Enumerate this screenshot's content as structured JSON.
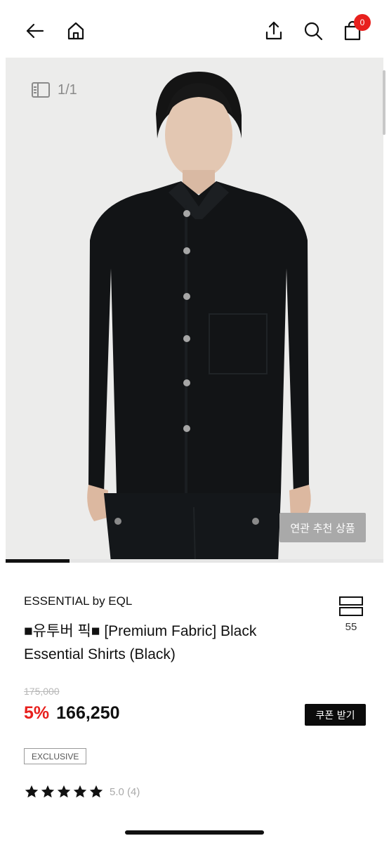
{
  "header": {
    "cart_count": "0"
  },
  "gallery": {
    "counter": "1/1",
    "related_label": "연관 추천 상품",
    "progress": 0.17
  },
  "product": {
    "brand": "ESSENTIAL by EQL",
    "title_line1": "■유투버 픽■ [Premium Fabric] Black",
    "title_line2": "Essential Shirts (Black)",
    "wish_count": "55",
    "original_price": "175,000",
    "discount": "5%",
    "price": "166,250",
    "coupon_label": "쿠폰 받기",
    "badge": "EXCLUSIVE",
    "rating": 5,
    "rating_text": "5.0 (4)"
  },
  "colors": {
    "accent_red": "#e8201d",
    "dark": "#0b0b0b"
  }
}
